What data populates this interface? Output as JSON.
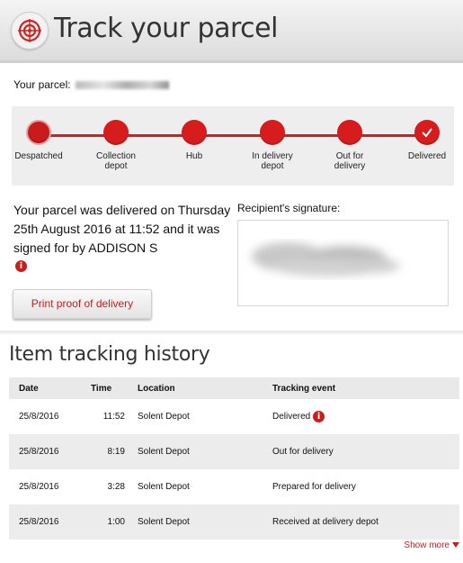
{
  "header": {
    "title": "Track your parcel",
    "logo_icon": "target-icon"
  },
  "parcel": {
    "label": "Your parcel:",
    "id_obscured": true
  },
  "steps": [
    {
      "label": "Despatched",
      "status": "current"
    },
    {
      "label": "Collection depot",
      "status": "done"
    },
    {
      "label": "Hub",
      "status": "done"
    },
    {
      "label": "In delivery depot",
      "status": "done"
    },
    {
      "label": "Out for delivery",
      "status": "done"
    },
    {
      "label": "Delivered",
      "status": "complete"
    }
  ],
  "delivery": {
    "message": "Your parcel was delivered on Thursday 25th August 2016 at 11:52 and it was signed for by ADDISON S",
    "info_icon": "i"
  },
  "signature": {
    "label": "Recipient's signature:"
  },
  "print_button": {
    "label": "Print proof of delivery"
  },
  "history": {
    "title": "Item tracking history",
    "columns": [
      "Date",
      "Time",
      "Location",
      "Tracking event"
    ],
    "rows": [
      {
        "date": "25/8/2016",
        "time": "11:52",
        "location": "Solent Depot",
        "event": "Delivered"
      },
      {
        "date": "25/8/2016",
        "time": "8:19",
        "location": "Solent Depot",
        "event": "Out for delivery"
      },
      {
        "date": "25/8/2016",
        "time": "3:28",
        "location": "Solent Depot",
        "event": "Prepared for delivery"
      },
      {
        "date": "25/8/2016",
        "time": "1:00",
        "location": "Solent Depot",
        "event": "Received at delivery depot"
      }
    ]
  },
  "show_more": {
    "label": "Show more"
  },
  "colors": {
    "accent": "#c41e1e",
    "progress_bg": "#eeeeee",
    "row_alt": "#ececec"
  }
}
